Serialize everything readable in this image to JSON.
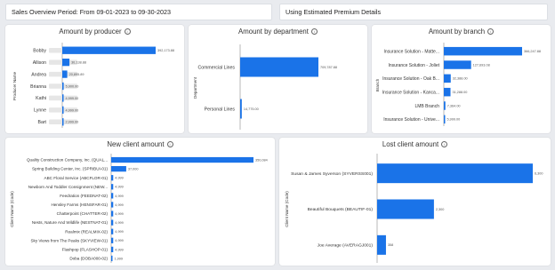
{
  "header": {
    "period_label": "Sales Overview Period: From 09-01-2023 to 09-30-2023",
    "premium_label": "Using Estimated Premium Details"
  },
  "colors": {
    "bar": "#1a73e8",
    "axis": "#888888",
    "text": "#333333",
    "placeholder": "#e6e6e6"
  },
  "icons": {
    "info": "info-circle-icon"
  },
  "chart_data": [
    {
      "type": "bar",
      "orientation": "horizontal",
      "title": "Amount by producer",
      "ylabel": "Producer Name",
      "categories": [
        "Bobby",
        "Allison",
        "Andrea",
        "Brianna",
        "Kathi",
        "Lynne",
        "Bart"
      ],
      "values": [
        392173.88,
        30138.88,
        20895.89,
        5900.0,
        4999.0,
        4999.0,
        2999.0
      ],
      "value_labels": [
        "392,173.88",
        "30,138.88",
        "20,895.89",
        "5,900.00",
        "4,999.00",
        "4,999.00",
        "2,999.00"
      ],
      "xlim": [
        0,
        392173.88
      ]
    },
    {
      "type": "bar",
      "orientation": "horizontal",
      "title": "Amount by department",
      "ylabel": "Department",
      "categories": [
        "Commercial Lines",
        "Personal Lines"
      ],
      "values": [
        709787.88,
        14775.0
      ],
      "value_labels": [
        "709,787.88",
        "14,775.00"
      ],
      "xlim": [
        0,
        709787.88
      ]
    },
    {
      "type": "bar",
      "orientation": "horizontal",
      "title": "Amount by branch",
      "ylabel": "Branch",
      "categories": [
        "Insurance Solution - Matte...",
        "Insurance Solution - Joliet",
        "Insurance Solution - Oak B...",
        "Insurance Solution - Kanca...",
        "LMB Branch",
        "Insurance Solution - Unive..."
      ],
      "values": [
        366247.88,
        127693.08,
        32388.0,
        31288.0,
        7364.0,
        5999.0
      ],
      "value_labels": [
        "366,247.88",
        "127,693.08",
        "32,388.00",
        "31,288.00",
        "7,364.00",
        "5,999.00"
      ],
      "xlim": [
        0,
        366247.88
      ]
    },
    {
      "type": "bar",
      "orientation": "horizontal",
      "title": "New client amount",
      "ylabel": "Client Name (Code)",
      "categories": [
        "Quality Construction Company, Inc. (QUAL...",
        "Spring Building Center, Inc. (SPRIBUI-01)",
        "ABC Floral Service (ABCFLOR-01)",
        "Newborn And Toddler Consignment (NEW...",
        "Feedration (FEEDNAT-02)",
        "Hensley Farms (HENSFAR-01)",
        "Chatterpoint (CHATTER-02)",
        "Nests, Nature And Wildlife (NESTNAT-01)",
        "Realmix (REALMIX-02)",
        "Sky Views from The Peaks (SKYVIEW-01)",
        "Flashpop (FLASHOP-01)",
        "Doba (DOBA000-02)"
      ],
      "values": [
        350084,
        37000,
        4999,
        4999,
        4999,
        4999,
        4999,
        4999,
        4999,
        4999,
        4999,
        1999
      ],
      "value_labels": [
        "350,084",
        "37,000",
        "4,999",
        "4,999",
        "4,999",
        "4,999",
        "4,999",
        "4,999",
        "4,999",
        "4,999",
        "4,999",
        "1,999"
      ],
      "xlim": [
        0,
        350084
      ]
    },
    {
      "type": "bar",
      "orientation": "horizontal",
      "title": "Lost client amount",
      "ylabel": "Client Name (Code)",
      "categories": [
        "Susan & James Syverson (SYVERSS001)",
        "Beautiful Bouquets (BEAUTIF-01)",
        "Joe Average (AVERAGJ001)"
      ],
      "values": [
        6300,
        2300,
        358
      ],
      "value_labels": [
        "6,300",
        "2,300",
        "358"
      ],
      "xlim": [
        0,
        6300
      ]
    }
  ]
}
